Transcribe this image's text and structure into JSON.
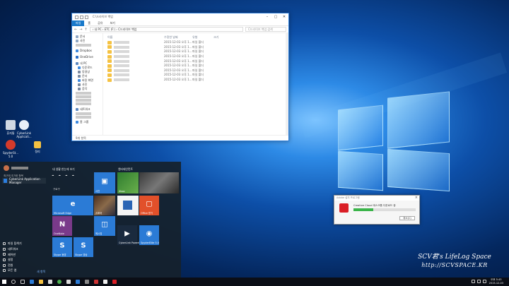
{
  "colors": {
    "accent": "#1979ca",
    "adobe_red": "#da1f26",
    "progress_green": "#3bb44a"
  },
  "desktop_icons": [
    {
      "label": "휴지통",
      "icon": "recycle-bin-icon",
      "color": "#cfd8e3"
    },
    {
      "label": "CyberLink Applicati...",
      "icon": "cyberlink-icon",
      "color": "#e7eef7"
    },
    {
      "label": "SpyderSt... 5.0",
      "icon": "spyder-icon",
      "color": "#d33a2b"
    },
    {
      "label": "정리",
      "icon": "folder-icon",
      "color": "#f5c242"
    }
  ],
  "explorer": {
    "title": "C:\\드라이브 백업",
    "ribbon_tabs": [
      "파일",
      "홈",
      "공유",
      "보기"
    ],
    "address": "› 내 PC › ETC (F:) › C드라이브 백업",
    "search_placeholder": "C드라이브 백업 검색",
    "columns": {
      "name": "이름",
      "date": "수정한 날짜",
      "type": "유형",
      "size": "크기"
    },
    "rows": [
      {
        "date": "2015-12-03 오후 1...",
        "type": "파일 폴더"
      },
      {
        "date": "2015-12-03 오후 1...",
        "type": "파일 폴더"
      },
      {
        "date": "2015-12-03 오후 1...",
        "type": "파일 폴더"
      },
      {
        "date": "2015-12-03 오후 1...",
        "type": "파일 폴더"
      },
      {
        "date": "2015-12-03 오후 1...",
        "type": "파일 폴더"
      },
      {
        "date": "2015-12-03 오후 1...",
        "type": "파일 폴더"
      },
      {
        "date": "2015-12-03 오후 1...",
        "type": "파일 폴더"
      },
      {
        "date": "2015-12-03 오후 1...",
        "type": "파일 폴더"
      },
      {
        "date": "2015-12-03 오후 1...",
        "type": "파일 폴더"
      }
    ],
    "nav": {
      "quick": [
        "문서",
        "사진"
      ],
      "dropbox": "Dropbox",
      "onedrive": "OneDrive",
      "thispc": "내 PC",
      "pc_items": [
        "다운로드",
        "동영상",
        "문서",
        "바탕 화면",
        "사진",
        "음악"
      ],
      "network": "네트워크",
      "homegroup": "홈 그룹"
    },
    "status": "9개 항목"
  },
  "start_menu": {
    "recent_label": "최근에 추가한 항목",
    "recent_app": "CyberLink Application Manager",
    "bottom_items": [
      "파일 탐색기",
      "네트워크",
      "제어판",
      "설정",
      "전원",
      "모든 앱"
    ],
    "new_label": "새 항목",
    "group1": "내 생활 한눈에 보기",
    "group2": "엔터테인먼트",
    "weather_label": "구로구",
    "tiles": [
      {
        "label": "사진",
        "icon": "photos-icon",
        "glyph": "▣"
      },
      {
        "label": "Microsoft Edge",
        "icon": "edge-icon",
        "glyph": "e"
      },
      {
        "label": "스토어",
        "icon": "store-icon",
        "glyph": ""
      },
      {
        "label": "OneNote",
        "icon": "onenote-icon",
        "glyph": "N"
      },
      {
        "label": "메시징",
        "icon": "messaging-icon",
        "glyph": "◫"
      },
      {
        "label": "Skype 동영",
        "icon": "skype-icon",
        "glyph": "S"
      },
      {
        "label": "Skype 영상",
        "icon": "skype-video-icon",
        "glyph": "S"
      },
      {
        "label": "Xbox",
        "icon": "xbox-icon",
        "glyph": ""
      },
      {
        "label": "",
        "icon": "movies-icon",
        "glyph": ""
      },
      {
        "label": "Office 받기",
        "icon": "office-icon",
        "glyph": "▢"
      },
      {
        "label": "CyberLink PowerDVD 15",
        "icon": "powerdvd-icon",
        "glyph": "▶"
      },
      {
        "label": "SpyderElite 5.0",
        "icon": "spyderelite-icon",
        "glyph": "◉"
      }
    ]
  },
  "adobe_popup": {
    "title": "Adobe 설치 프로그램",
    "message": "Creative Cloud 데스크톱 다운로드 중",
    "progress": 0.32,
    "cancel": "취소(C)"
  },
  "taskbar": {
    "time": "오후 5:43",
    "date": "2015-12-03"
  },
  "watermark": {
    "line1": "SCV君's LifeLog Space",
    "line2": "http://SCVSPACE.KR"
  }
}
